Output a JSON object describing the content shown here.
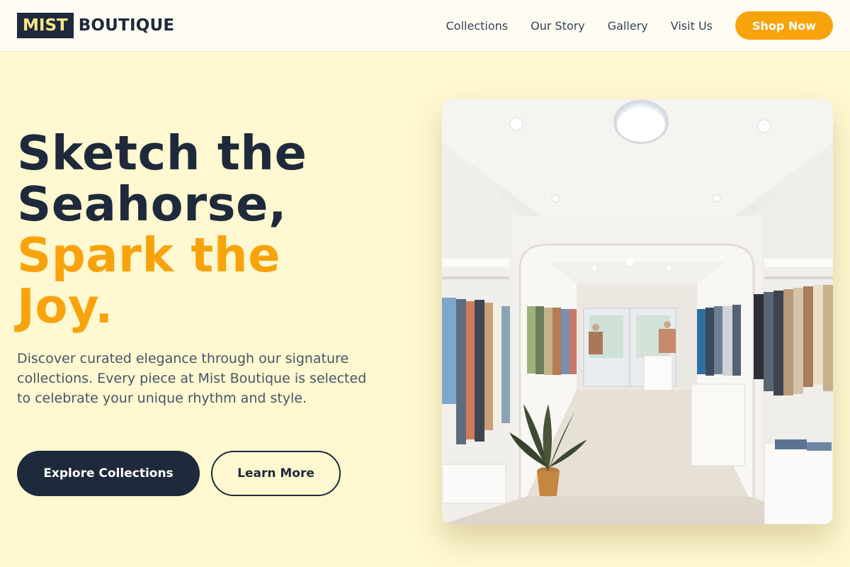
{
  "brand": {
    "logo_box": "MIST",
    "logo_text": "BOUTIQUE"
  },
  "nav": {
    "links": [
      "Collections",
      "Our Story",
      "Gallery",
      "Visit Us"
    ],
    "cta": "Shop Now"
  },
  "hero": {
    "title_lines": [
      {
        "text": "Sketch the",
        "style": "dark"
      },
      {
        "text": "Seahorse,",
        "style": "dark"
      },
      {
        "text": "Spark the",
        "style": "accent"
      },
      {
        "text": "Joy.",
        "style": "accent"
      }
    ],
    "description": "Discover curated elegance through our signature collections. Every piece at Mist Boutique is selected to celebrate your unique rhythm and style.",
    "primary_button": "Explore Collections",
    "secondary_button": "Learn More",
    "image": {
      "subject": "bright white boutique interior with clothing racks, a potted plant and an archway"
    }
  },
  "colors": {
    "page_background": "#fff8d0",
    "navbar_background": "#fffdf3",
    "dark": "#1e293b",
    "accent": "#f9a30c",
    "body_text": "#475569"
  }
}
